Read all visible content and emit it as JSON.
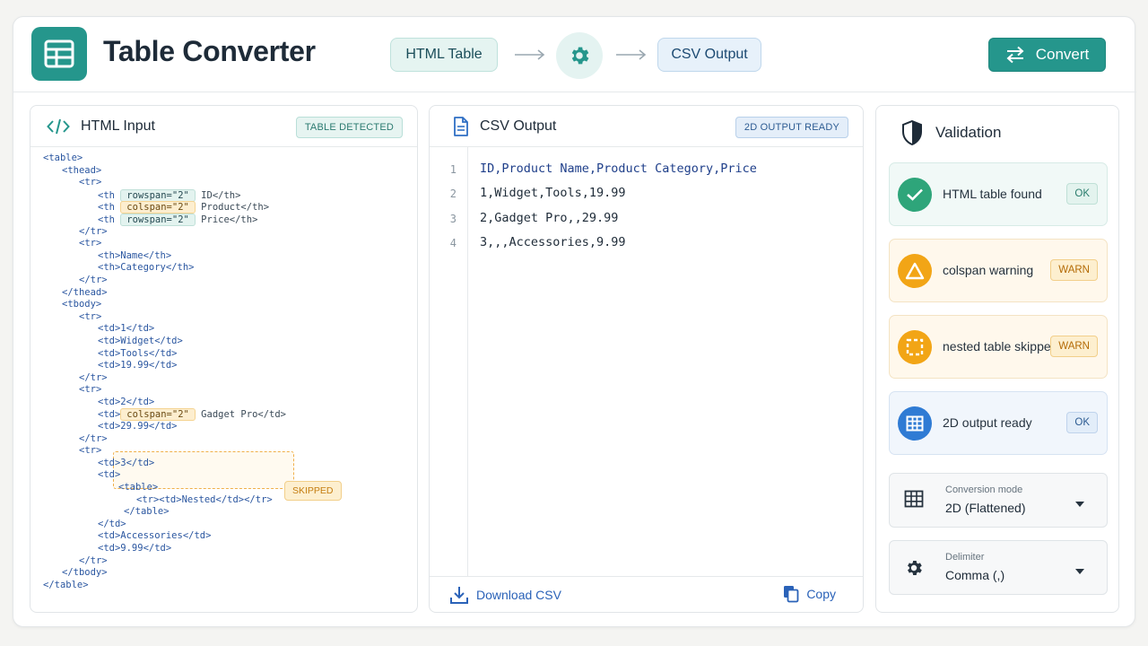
{
  "header": {
    "title": "Table Converter",
    "step_input": "HTML Table",
    "step_output": "CSV Output",
    "convert_label": "Convert"
  },
  "input_panel": {
    "title": "HTML Input",
    "badge": "TABLE DETECTED",
    "skipped_label": "SKIPPED",
    "code": {
      "l1": "<table>",
      "l2": "<thead>",
      "l3": "<tr>",
      "l4_open": "<th",
      "l4_attr": "rowspan=\"2\"",
      "l4_rest": "ID</th>",
      "l5_open": "<th",
      "l5_attr": "colspan=\"2\"",
      "l5_rest": "Product</th>",
      "l6_open": "<th",
      "l6_attr": "rowspan=\"2\"",
      "l6_rest": "Price</th>",
      "l7": "</tr>",
      "l8": "<tr>",
      "l9": "<th>Name</th>",
      "l10": "<th>Category</th>",
      "l11": "</tr>",
      "l12": "</thead>",
      "l13": "<tbody>",
      "l14": "<tr>",
      "l15": "<td>1</td>",
      "l16": "<td>Widget</td>",
      "l17": "<td>Tools</td>",
      "l18": "<td>19.99</td>",
      "l19": "</tr>",
      "l20": "<tr>",
      "l21": "<td>2</td>",
      "l22_open": "<td>",
      "l22_attr": "colspan=\"2\"",
      "l22_rest": "Gadget Pro</td>",
      "l23": "<td>29.99</td>",
      "l24": "</tr>",
      "l25": "<tr>",
      "l26": "<td>3</td>",
      "l27": "<td>",
      "l28": "<table>",
      "l29": "<tr><td>Nested</td></tr>",
      "l30": "</table>",
      "l31": "</td>",
      "l32": "<td>Accessories</td>",
      "l33": "<td>9.99</td>",
      "l34": "</tr>",
      "l35": "</tbody>",
      "l36": "</table>"
    }
  },
  "output_panel": {
    "title": "CSV Output",
    "badge": "2D OUTPUT READY",
    "lines": [
      {
        "num": "1",
        "text": "ID,Product Name,Product Category,Price"
      },
      {
        "num": "2",
        "text": "1,Widget,Tools,19.99"
      },
      {
        "num": "3",
        "text": "2,Gadget Pro,,29.99"
      },
      {
        "num": "4",
        "text": "3,,,Accessories,9.99"
      }
    ],
    "download_label": "Download CSV",
    "copy_label": "Copy"
  },
  "validation": {
    "title": "Validation",
    "checks": [
      {
        "label": "HTML table found",
        "status": "OK"
      },
      {
        "label": "colspan warning",
        "status": "WARN"
      },
      {
        "label": "nested table skipped",
        "status": "WARN"
      },
      {
        "label": "2D output ready",
        "status": "OK"
      }
    ],
    "mode": {
      "label": "Conversion mode",
      "value": "2D (Flattened)"
    },
    "delimiter": {
      "label": "Delimiter",
      "value": "Comma (,)"
    }
  },
  "colors": {
    "accent": "#25968c",
    "ok": "#2ea57a",
    "warn": "#f2a516",
    "info": "#2f7bd4"
  }
}
